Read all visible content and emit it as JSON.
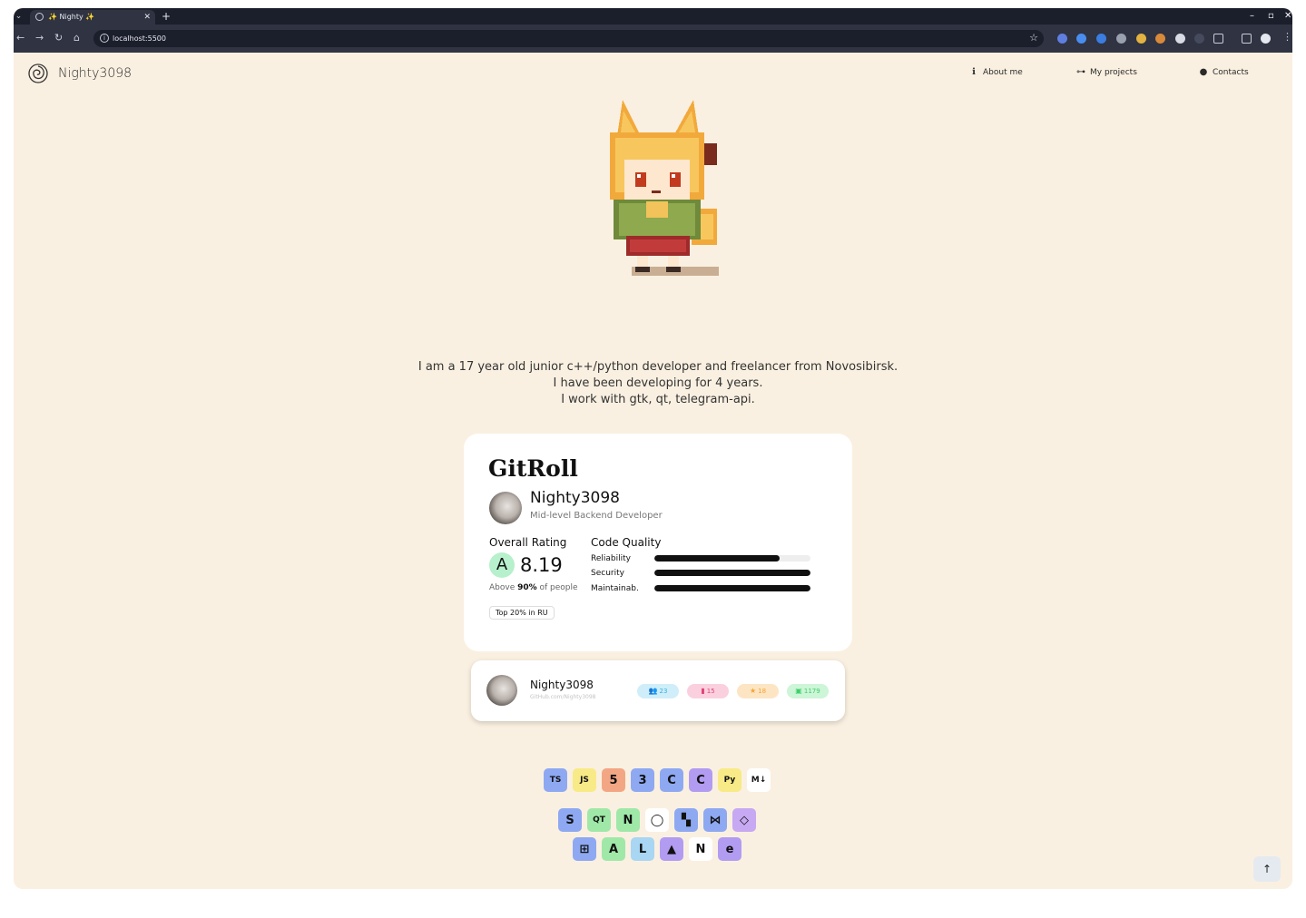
{
  "browser": {
    "tab_title": "✨ Nighty ✨",
    "url": "localhost:5500"
  },
  "header": {
    "brand": "Nighty3098",
    "nav": [
      {
        "label": "About me",
        "icon": "info-icon"
      },
      {
        "label": "My projects",
        "icon": "project-tree-icon"
      },
      {
        "label": "Contacts",
        "icon": "user-icon"
      }
    ]
  },
  "intro": {
    "lines": [
      "I am a 17 year old junior c++/python developer and freelancer from Novosibirsk.",
      "I have been developing for 4 years.",
      "I work with gtk, qt, telegram-api."
    ]
  },
  "gitroll": {
    "title": "GitRoll",
    "username": "Nighty3098",
    "role": "Mid-level Backend Developer",
    "overall_label": "Overall Rating",
    "grade": "A",
    "score": "8.19",
    "above_prefix": "Above ",
    "above_value": "90%",
    "above_suffix": " of people",
    "rank": "Top 20% in RU",
    "quality_label": "Code Quality",
    "metrics": [
      {
        "label": "Reliability",
        "fraction": 0.8
      },
      {
        "label": "Security",
        "fraction": 1.0
      },
      {
        "label": "Maintainab.",
        "fraction": 1.0
      }
    ]
  },
  "github": {
    "username": "Nighty3098",
    "subtitle": "GitHub.com/Nighty3098",
    "stats": [
      {
        "name": "followers",
        "value": "23",
        "icon": "users-icon",
        "bg": "#cfeef9",
        "fg": "#3ab1e0"
      },
      {
        "name": "repos",
        "value": "15",
        "icon": "repo-icon",
        "bg": "#fbd0de",
        "fg": "#e2437a"
      },
      {
        "name": "stars",
        "value": "18",
        "icon": "star-icon",
        "bg": "#fde5c3",
        "fg": "#f3a531"
      },
      {
        "name": "commits",
        "value": "1179",
        "icon": "commit-icon",
        "bg": "#cdf5d7",
        "fg": "#3fcf6a"
      }
    ]
  },
  "tech_stack": {
    "row1": [
      {
        "name": "typescript",
        "label": "TS",
        "bg": "#8ea9f2"
      },
      {
        "name": "javascript",
        "label": "JS",
        "bg": "#f8ea86"
      },
      {
        "name": "html5",
        "label": "5",
        "bg": "#f3a684"
      },
      {
        "name": "css3",
        "label": "3",
        "bg": "#8ea9f2"
      },
      {
        "name": "cpp",
        "label": "C",
        "bg": "#8ea9f2"
      },
      {
        "name": "c",
        "label": "C",
        "bg": "#b29cf2"
      },
      {
        "name": "python",
        "label": "Py",
        "bg": "#f8ea86"
      },
      {
        "name": "markdown",
        "label": "M↓",
        "bg": "#ffffff"
      }
    ],
    "row2": [
      {
        "name": "sublime",
        "label": "S",
        "bg": "#8ea9f2"
      },
      {
        "name": "qt",
        "label": "QT",
        "bg": "#9fe8a8"
      },
      {
        "name": "nodejs",
        "label": "N",
        "bg": "#9fe8a8"
      },
      {
        "name": "github",
        "label": "◯",
        "bg": "#ffffff"
      },
      {
        "name": "gitlab",
        "label": "▚",
        "bg": "#8ea9f2"
      },
      {
        "name": "vscode",
        "label": "⋈",
        "bg": "#8ea9f2"
      },
      {
        "name": "obsidian",
        "label": "◇",
        "bg": "#c7a8f2"
      }
    ],
    "row3": [
      {
        "name": "windows",
        "label": "⊞",
        "bg": "#8ea9f2"
      },
      {
        "name": "android",
        "label": "A",
        "bg": "#9fe8a8"
      },
      {
        "name": "linux",
        "label": "L",
        "bg": "#a8d6f3"
      },
      {
        "name": "arch",
        "label": "▲",
        "bg": "#b29cf2"
      },
      {
        "name": "notion",
        "label": "N",
        "bg": "#ffffff"
      },
      {
        "name": "emacs",
        "label": "e",
        "bg": "#b29cf2"
      }
    ]
  },
  "scroll_top": "↑"
}
